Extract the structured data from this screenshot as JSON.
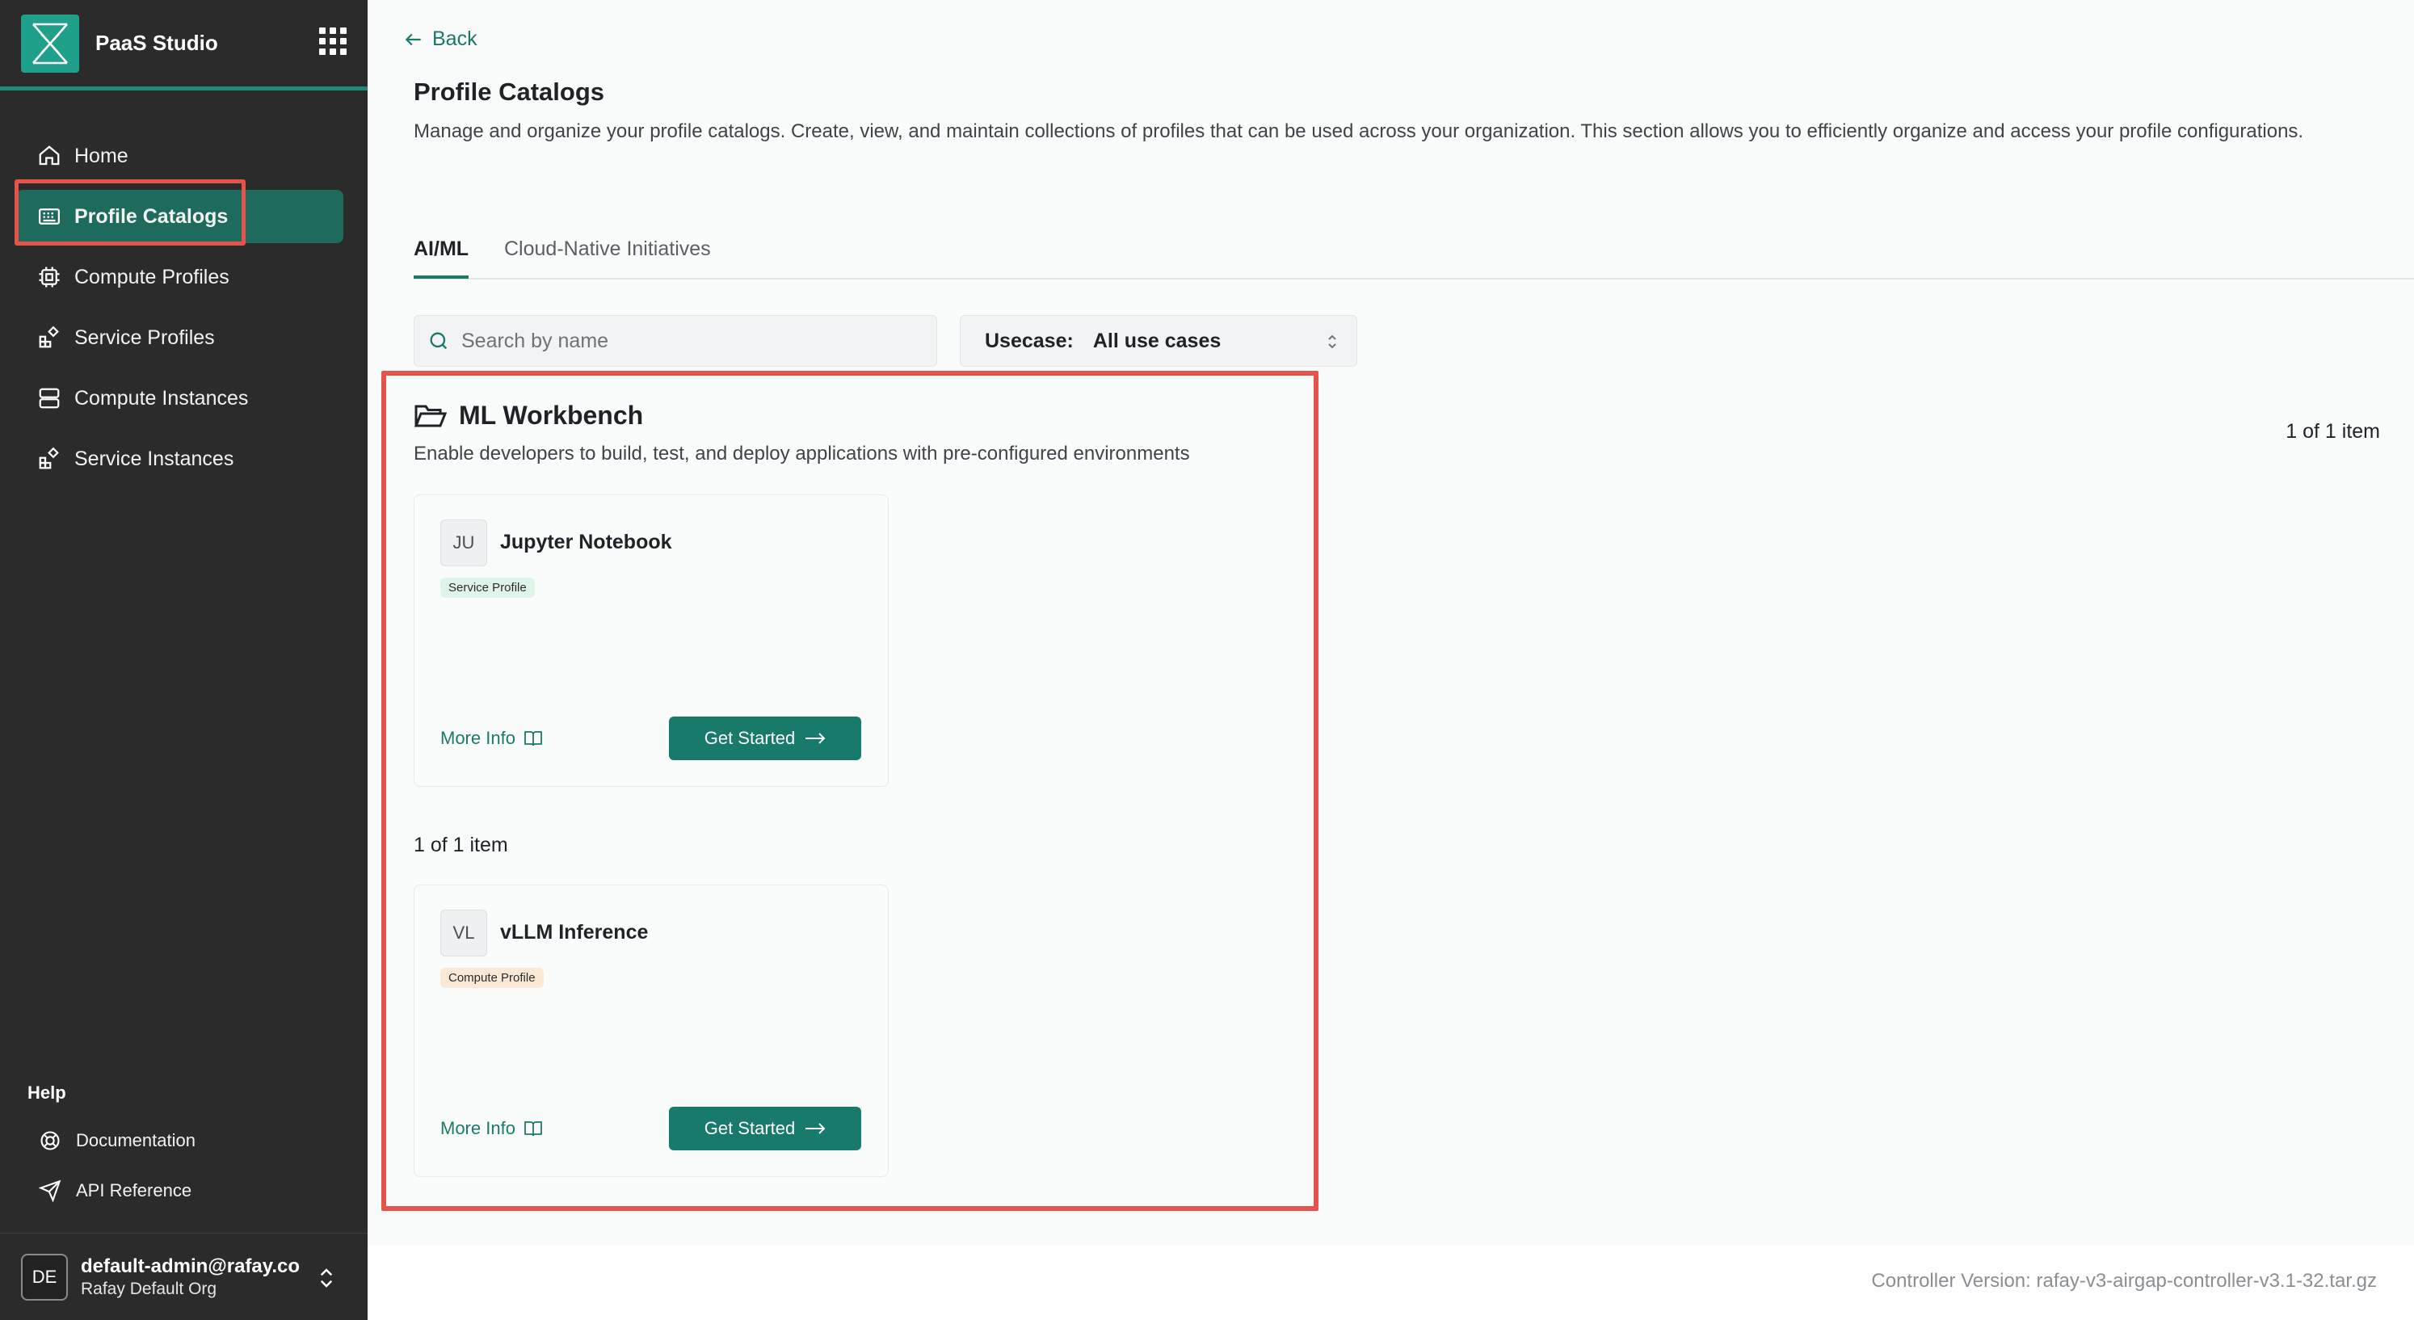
{
  "app": {
    "title": "PaaS Studio"
  },
  "sidebar": {
    "items": [
      {
        "label": "Home",
        "icon": "home-icon"
      },
      {
        "label": "Profile Catalogs",
        "icon": "catalog-icon",
        "active": true
      },
      {
        "label": "Compute Profiles",
        "icon": "cpu-icon"
      },
      {
        "label": "Service Profiles",
        "icon": "blocks-icon"
      },
      {
        "label": "Compute Instances",
        "icon": "server-icon"
      },
      {
        "label": "Service Instances",
        "icon": "blocks-icon"
      }
    ],
    "help_label": "Help",
    "help_items": [
      {
        "label": "Documentation",
        "icon": "lifebuoy-icon"
      },
      {
        "label": "API Reference",
        "icon": "send-icon"
      }
    ],
    "user": {
      "initials": "DE",
      "email": "default-admin@rafay.co",
      "org": "Rafay Default Org"
    }
  },
  "main": {
    "back_label": "Back",
    "title": "Profile Catalogs",
    "description": "Manage and organize your profile catalogs. Create, view, and maintain collections of profiles that can be used across your organization. This section allows you to efficiently organize and access your profile configurations.",
    "tabs": [
      {
        "label": "AI/ML",
        "active": true
      },
      {
        "label": "Cloud-Native Initiatives",
        "active": false
      }
    ],
    "search": {
      "placeholder": "Search by name",
      "value": ""
    },
    "usecase": {
      "label": "Usecase:",
      "value": "All use cases"
    },
    "pager_top": "1 of 1 item",
    "section": {
      "title": "ML Workbench",
      "description": "Enable developers to build, test, and deploy applications with pre-configured environments"
    },
    "cards": [
      {
        "initials": "JU",
        "title": "Jupyter Notebook",
        "badge": "Service Profile",
        "more_info": "More Info",
        "button": "Get Started"
      },
      {
        "initials": "VL",
        "title": "vLLM Inference",
        "badge": "Compute Profile",
        "more_info": "More Info",
        "button": "Get Started"
      }
    ],
    "pager_inline": "1 of 1 item"
  },
  "footer": {
    "version": "Controller Version: rafay-v3-airgap-controller-v3.1-32.tar.gz"
  },
  "colors": {
    "accent": "#187a6a",
    "sidebar_bg": "#2b2b2b",
    "highlight": "#e5534b"
  }
}
